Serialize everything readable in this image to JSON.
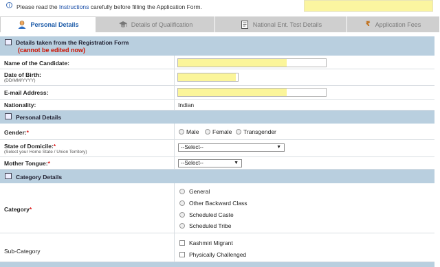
{
  "notice": {
    "before": "Please read the ",
    "link": "Instructions",
    "after": " carefully before filling the Application Form."
  },
  "tabs": [
    {
      "label": "Personal Details",
      "icon": "person-icon",
      "active": true
    },
    {
      "label": "Details of Qualification",
      "icon": "graduation-cap-icon",
      "active": false
    },
    {
      "label": "National Ent. Test Details",
      "icon": "document-icon",
      "active": false
    },
    {
      "label": "Application Fees",
      "icon": "rupee-icon",
      "active": false
    }
  ],
  "registration": {
    "title": "Details taken from the Registration Form",
    "note": "(cannot be edited now)",
    "name_label": "Name of the Candidate:",
    "dob_label": "Date of Birth:",
    "dob_format": "(DD/MM/YYYY)",
    "email_label": "E-mail Address:",
    "nationality_label": "Nationality:",
    "nationality_value": "Indian"
  },
  "personal": {
    "title": "Personal Details",
    "gender_label": "Gender:",
    "gender_options": [
      "Male",
      "Female",
      "Transgender"
    ],
    "domicile_label": "State of Domicile:",
    "domicile_hint": "(Select your Home State / Union Territory)",
    "domicile_value": "--Select--",
    "tongue_label": "Mother Tongue:",
    "tongue_value": "--Select--",
    "required_mark": "*"
  },
  "category": {
    "title": "Category Details",
    "category_label": "Category",
    "category_options": [
      "General",
      "Other Backward Class",
      "Scheduled Caste",
      "Scheduled Tribe"
    ],
    "subcategory_label": "Sub-Category",
    "subcategory_options": [
      "Kashmiri Migrant",
      "Physically Challenged"
    ],
    "required_mark": "*"
  },
  "colors": {
    "section_header": "#b9cfdf",
    "highlight": "#fbf59a",
    "link": "#1b4fa8",
    "required": "#dd1111"
  }
}
